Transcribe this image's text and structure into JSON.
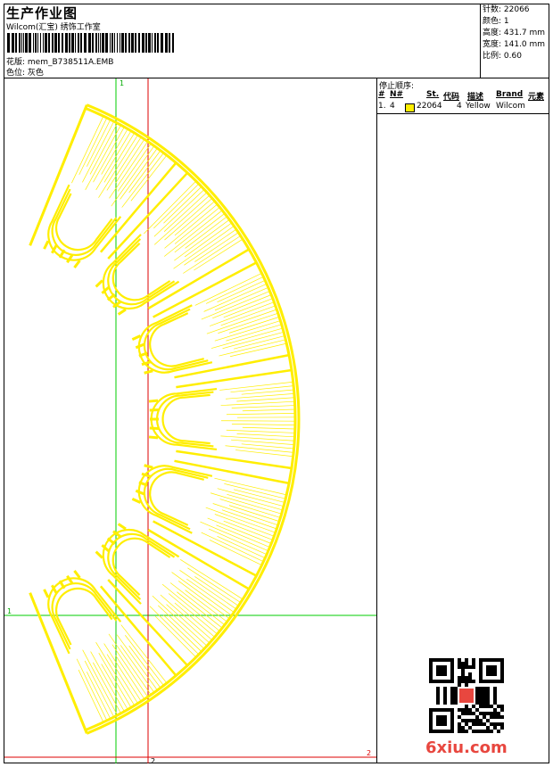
{
  "header": {
    "title": "生产作业图",
    "subtitle": "Wilcom(汇宝) 绣饰工作室",
    "file_label": "花版: mem_B738511A.EMB",
    "color_label": "色位: 灰色"
  },
  "stats": {
    "stitches": "针数: 22066",
    "colors": "颜色: 1",
    "height": "高度: 431.7 mm",
    "width": "宽度: 141.0 mm",
    "scale": "比例: 0.60"
  },
  "stop_sequence": {
    "title": "停止顺序:",
    "headers": [
      "#",
      "N#",
      "St.",
      "代码",
      "描述",
      "Brand",
      "元素"
    ],
    "rows": [
      {
        "index": "1.",
        "needle": "4",
        "stitches": "22064",
        "code": "4",
        "description": "Yellow",
        "brand": "Wilcom",
        "swatch": "#ffee00"
      }
    ]
  },
  "guides": {
    "marker_1_top": "1",
    "marker_1_left": "1",
    "marker_2_bottom": "2",
    "marker_2_right": "2"
  },
  "colors": {
    "thread": "#ffee00",
    "guide_green": "#00cc00",
    "guide_red": "#dd0000"
  },
  "watermark": "6xiu.com"
}
